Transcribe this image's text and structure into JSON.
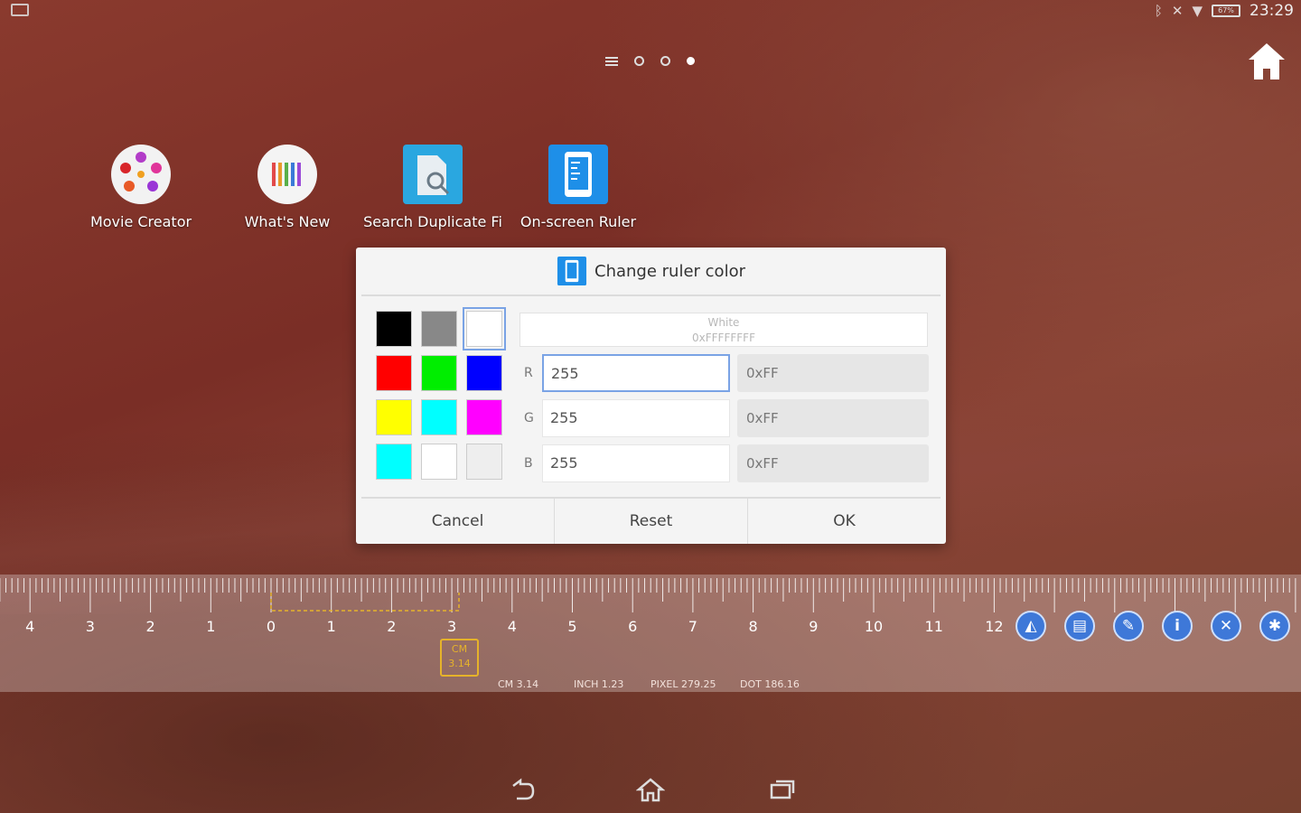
{
  "status_bar": {
    "time": "23:29",
    "battery": "67%",
    "icons": [
      "notification-icon",
      "bluetooth-icon",
      "mute-icon",
      "wifi-icon",
      "battery-icon"
    ]
  },
  "page_indicator": {
    "pages": 3,
    "active": 3
  },
  "apps": [
    {
      "label": "Movie Creator",
      "icon": "movie-creator-icon"
    },
    {
      "label": "What's New",
      "icon": "whats-new-icon"
    },
    {
      "label": "Search Duplicate Fi",
      "icon": "search-duplicate-icon"
    },
    {
      "label": "On-screen Ruler",
      "icon": "ruler-app-icon"
    }
  ],
  "dialog": {
    "title": "Change ruler color",
    "preview_name": "White",
    "preview_hex": "0xFFFFFFFF",
    "swatch_colors": [
      "#000000",
      "#888888",
      "#ffffff",
      "#ff0000",
      "#00ee00",
      "#0000ff",
      "#ffff00",
      "#00ffff",
      "#ff00ff",
      "#00ffff",
      "#ffffff",
      "#eeeeee"
    ],
    "r_label": "R",
    "r_value": "255",
    "r_hex": "0xFF",
    "g_label": "G",
    "g_value": "255",
    "g_hex": "0xFF",
    "b_label": "B",
    "b_value": "255",
    "b_hex": "0xFF",
    "cancel": "Cancel",
    "reset": "Reset",
    "ok": "OK"
  },
  "ruler": {
    "numbers": [
      "4",
      "3",
      "2",
      "1",
      "0",
      "1",
      "2",
      "3",
      "4",
      "5",
      "6",
      "7",
      "8",
      "9",
      "10",
      "11",
      "12"
    ],
    "marker_unit": "CM",
    "marker_value": "3.14",
    "cm": "CM 3.14",
    "inch": "INCH 1.23",
    "pixel": "PIXEL 279.25",
    "dot": "DOT 186.16",
    "buttons": [
      "ruler-mode-icon",
      "save-icon",
      "color-brush-icon",
      "info-icon",
      "close-icon",
      "settings-icon"
    ]
  },
  "colors": {
    "accent": "#3e78d8",
    "marker": "#e6b32a"
  }
}
